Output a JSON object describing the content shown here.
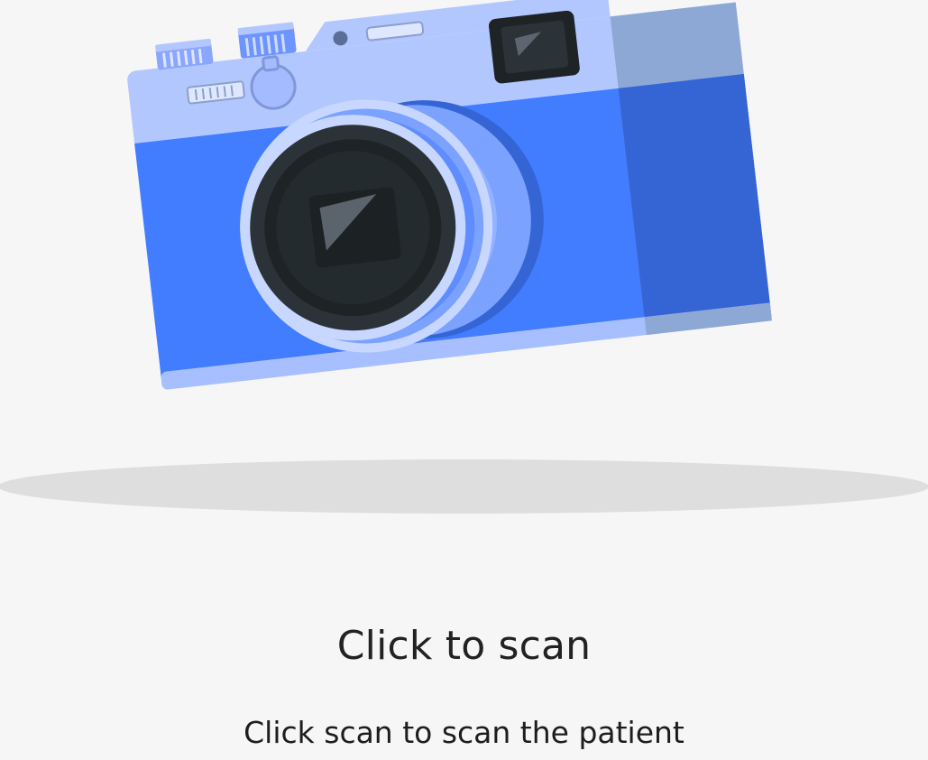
{
  "scan": {
    "title": "Click to scan",
    "subtitle": "Click scan to scan the patient"
  },
  "icons": {
    "illustration": "camera-icon"
  },
  "colors": {
    "background": "#f6f6f6",
    "camera_body": "#427cff",
    "camera_top": "#b3c7ff",
    "camera_side": "#3564d4",
    "lens_dark": "#1e2326",
    "shadow": "#dedede",
    "text": "#222222"
  }
}
